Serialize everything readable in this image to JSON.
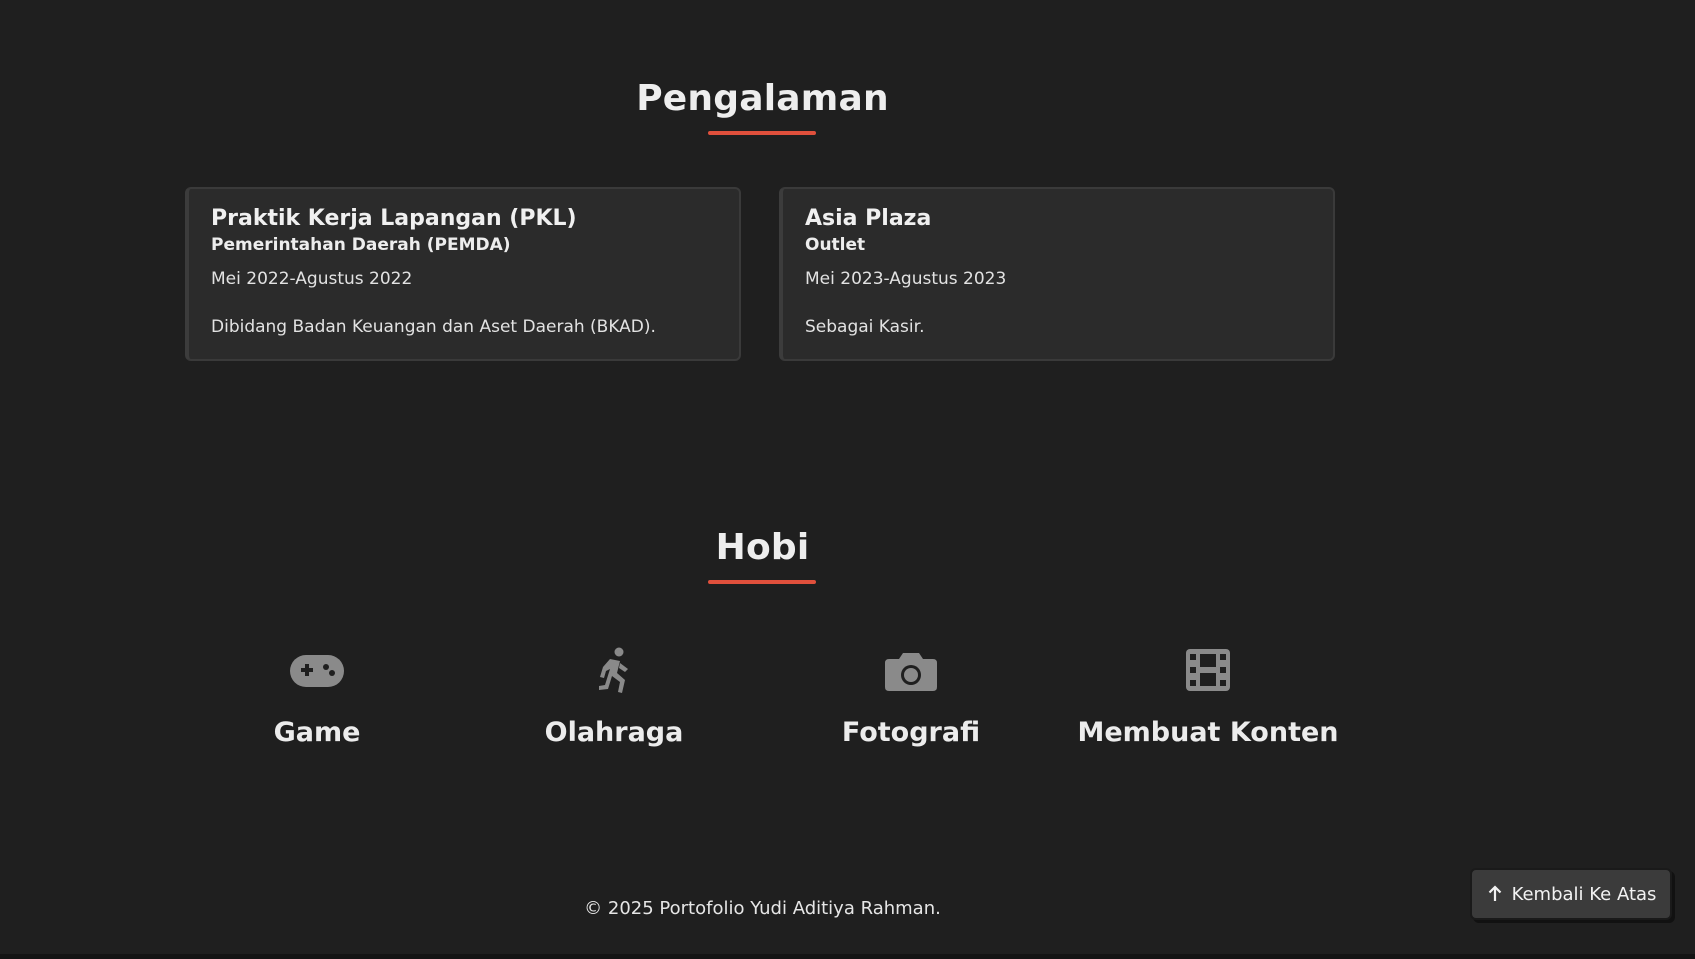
{
  "experience": {
    "title": "Pengalaman",
    "items": [
      {
        "job_title": "Praktik Kerja Lapangan (PKL)",
        "organization": "Pemerintahan Daerah (PEMDA)",
        "period": "Mei 2022-Agustus 2022",
        "description": "Dibidang Badan Keuangan dan Aset Daerah (BKAD)."
      },
      {
        "job_title": "Asia Plaza",
        "organization": "Outlet",
        "period": "Mei 2023-Agustus 2023",
        "description": "Sebagai Kasir."
      }
    ]
  },
  "hobbies": {
    "title": "Hobi",
    "items": [
      {
        "label": "Game",
        "icon": "gamepad-icon"
      },
      {
        "label": "Olahraga",
        "icon": "running-icon"
      },
      {
        "label": "Fotografi",
        "icon": "camera-icon"
      },
      {
        "label": "Membuat Konten",
        "icon": "film-icon"
      }
    ]
  },
  "footer": {
    "copyright": "© 2025 Portofolio Yudi Aditiya Rahman."
  },
  "back_to_top": {
    "label": "Kembali Ke Atas",
    "icon": "arrow-up-icon"
  },
  "colors": {
    "background": "#1f1f1f",
    "card_background": "#2b2b2b",
    "accent_underline": "#e0503c",
    "icon_gray": "#8a8a8a"
  }
}
